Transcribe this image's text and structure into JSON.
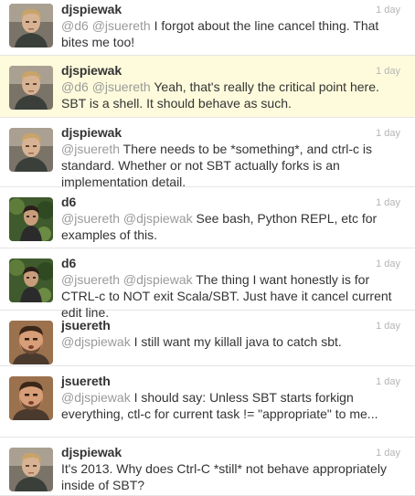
{
  "tweets": [
    {
      "user": "djspiewak",
      "avatar": "avatar-djspiewak",
      "time": "1 day",
      "highlight": false,
      "parts": [
        {
          "t": "@d6",
          "m": true
        },
        {
          "t": " "
        },
        {
          "t": "@jsuereth",
          "m": true
        },
        {
          "t": " I forgot about the line cancel thing. That bites me too!"
        }
      ]
    },
    {
      "user": "djspiewak",
      "avatar": "avatar-djspiewak",
      "time": "1 day",
      "highlight": true,
      "parts": [
        {
          "t": "@d6",
          "m": true
        },
        {
          "t": " "
        },
        {
          "t": "@jsuereth",
          "m": true
        },
        {
          "t": " Yeah, that's really the critical point here. SBT is a shell. It should behave as such."
        }
      ]
    },
    {
      "user": "djspiewak",
      "avatar": "avatar-djspiewak",
      "time": "1 day",
      "highlight": false,
      "parts": [
        {
          "t": "@jsuereth",
          "m": true
        },
        {
          "t": " There needs to be *something*, and ctrl-c is standard. Whether or not SBT actually forks is an implementation detail."
        }
      ]
    },
    {
      "user": "d6",
      "avatar": "avatar-d6",
      "time": "1 day",
      "highlight": false,
      "parts": [
        {
          "t": "@jsuereth",
          "m": true
        },
        {
          "t": " "
        },
        {
          "t": "@djspiewak",
          "m": true
        },
        {
          "t": " See bash, Python REPL, etc for examples of this."
        }
      ]
    },
    {
      "user": "d6",
      "avatar": "avatar-d6",
      "time": "1 day",
      "highlight": false,
      "parts": [
        {
          "t": "@jsuereth",
          "m": true
        },
        {
          "t": " "
        },
        {
          "t": "@djspiewak",
          "m": true
        },
        {
          "t": " The thing I want honestly is for CTRL-c to NOT exit Scala/SBT. Just have it cancel current edit line."
        }
      ]
    },
    {
      "user": "jsuereth",
      "avatar": "avatar-jsuereth",
      "time": "1 day",
      "highlight": false,
      "parts": [
        {
          "t": "@djspiewak",
          "m": true
        },
        {
          "t": " I still want my killall java to catch sbt."
        }
      ]
    },
    {
      "user": "jsuereth",
      "avatar": "avatar-jsuereth",
      "time": "1 day",
      "highlight": false,
      "parts": [
        {
          "t": "@djspiewak",
          "m": true
        },
        {
          "t": " I should say:  Unless SBT starts forkign everything, ctl-c for current task != \"appropriate\" to me..."
        }
      ]
    },
    {
      "user": "djspiewak",
      "avatar": "avatar-djspiewak",
      "time": "1 day",
      "highlight": false,
      "parts": [
        {
          "t": "It's 2013. Why does Ctrl-C *still* not behave appropriately inside of SBT?"
        }
      ]
    }
  ],
  "colors": {
    "mention": "#9a9a9a",
    "highlight_bg": "#fefbdc",
    "timestamp": "#b5b5b5"
  }
}
